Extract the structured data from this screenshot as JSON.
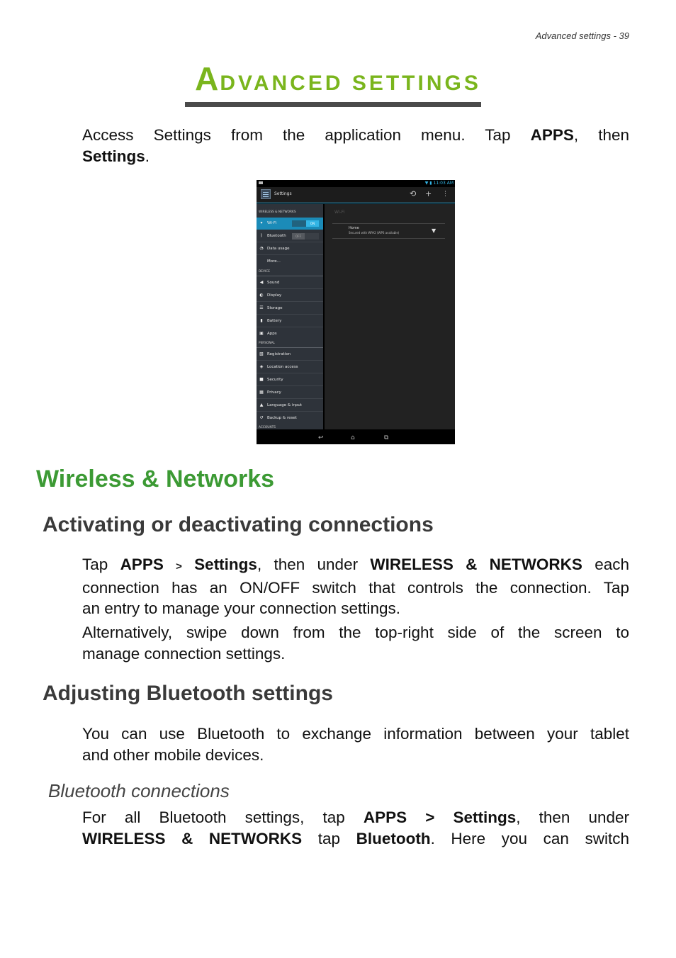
{
  "running_head": "Advanced settings - 39",
  "chapter_title": {
    "first_letter": "A",
    "rest": "DVANCED SETTINGS"
  },
  "intro": {
    "line1": [
      "Access Settings from the application menu. Tap ",
      "APPS",
      ", then"
    ],
    "line2": [
      "Settings",
      "."
    ]
  },
  "screenshot": {
    "status_time": "11:03 AM",
    "action_bar_title": "Settings",
    "action_icons": [
      "sync-icon",
      "add-icon",
      "overflow-menu-icon"
    ],
    "sections": [
      {
        "header": "WIRELESS & NETWORKS",
        "items": [
          {
            "label": "Wi-Fi",
            "icon": "wifi-icon",
            "toggle": "ON",
            "active": true
          },
          {
            "label": "Bluetooth",
            "icon": "bluetooth-icon",
            "toggle": "OFF"
          },
          {
            "label": "Data usage",
            "icon": "data-usage-icon"
          },
          {
            "label": "More...",
            "icon": ""
          }
        ]
      },
      {
        "header": "DEVICE",
        "items": [
          {
            "label": "Sound",
            "icon": "sound-icon"
          },
          {
            "label": "Display",
            "icon": "display-icon"
          },
          {
            "label": "Storage",
            "icon": "storage-icon"
          },
          {
            "label": "Battery",
            "icon": "battery-icon"
          },
          {
            "label": "Apps",
            "icon": "apps-icon"
          }
        ]
      },
      {
        "header": "PERSONAL",
        "items": [
          {
            "label": "Registration",
            "icon": "registration-icon"
          },
          {
            "label": "Location access",
            "icon": "location-icon"
          },
          {
            "label": "Security",
            "icon": "lock-icon"
          },
          {
            "label": "Privacy",
            "icon": "privacy-icon"
          },
          {
            "label": "Language & input",
            "icon": "language-icon"
          },
          {
            "label": "Backup & reset",
            "icon": "backup-icon"
          }
        ]
      },
      {
        "header": "ACCOUNTS",
        "items": []
      }
    ],
    "detail_title": "Wi-Fi",
    "network": {
      "name": "Home",
      "status": "Secured with WPA2 (WPS available)"
    },
    "nav_icons": [
      "back-icon",
      "home-icon",
      "recents-icon"
    ]
  },
  "section_heading": "Wireless & Networks",
  "subsection1": {
    "heading": "Activating or deactivating connections",
    "para1": {
      "l1": [
        "Tap ",
        "APPS",
        ">",
        "Settings",
        ", then under ",
        "WIRELESS & NETWORKS",
        " each"
      ],
      "l2": "connection has an ON/OFF switch that controls the connection. Tap",
      "l3": "an entry to manage your connection settings."
    },
    "para2": {
      "l1": "Alternatively, swipe down from the top-right side of the screen to",
      "l2": "manage connection settings."
    }
  },
  "subsection2": {
    "heading": "Adjusting Bluetooth settings",
    "para1": {
      "l1": "You can use Bluetooth to exchange information between your tablet",
      "l2": "and other mobile devices."
    }
  },
  "subsubsection": {
    "heading": "Bluetooth connections",
    "para1": {
      "l1": [
        "For all Bluetooth settings, tap ",
        "APPS > Settings",
        ", then under"
      ],
      "l2": [
        "WIRELESS & NETWORKS",
        " tap ",
        "Bluetooth",
        ". Here you can switch"
      ]
    }
  }
}
